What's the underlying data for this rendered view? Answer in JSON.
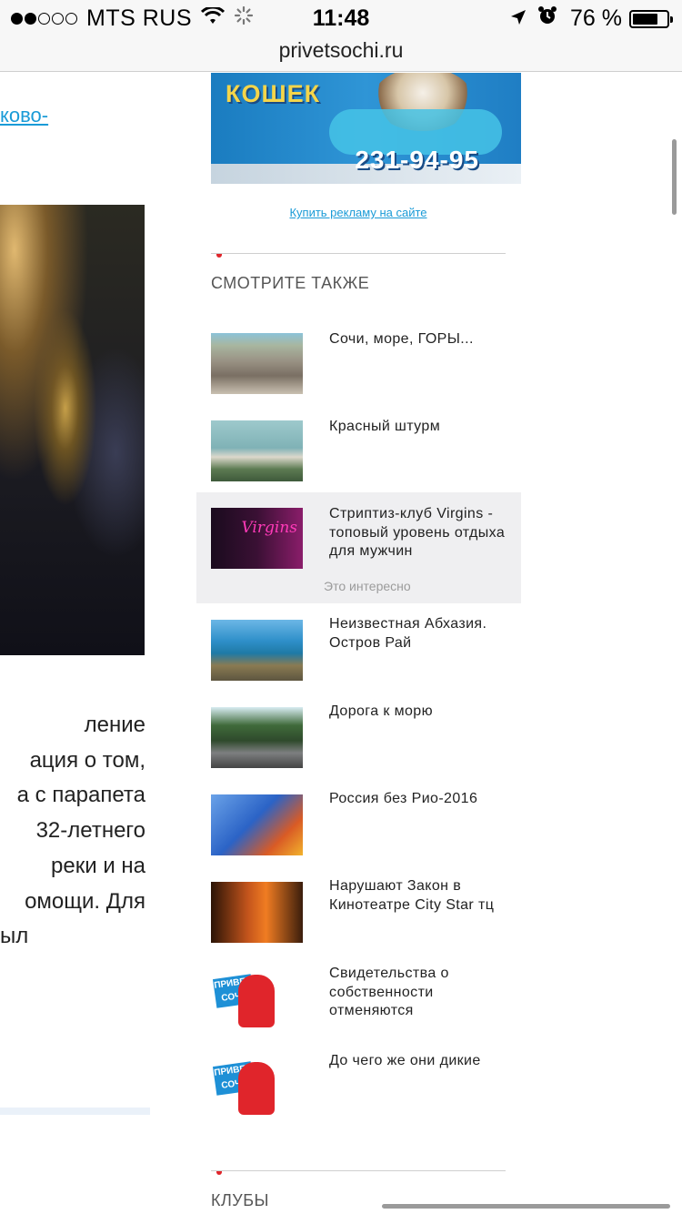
{
  "status_bar": {
    "carrier": "MTS RUS",
    "time": "11:48",
    "battery": "76 %",
    "battery_level": 0.76,
    "signal_bars_filled": 2,
    "signal_bars_total": 5
  },
  "url_bar": {
    "domain": "privetsochi.ru"
  },
  "article": {
    "link_text": "ково-",
    "text_lines": [
      "ление",
      "ация о том,",
      "а с парапета",
      "32-летнего",
      "реки и на",
      "омощи. Для",
      "ыл"
    ]
  },
  "ad": {
    "title": "КОШЕК",
    "phone": "231-94-95",
    "buy_link": "Купить рекламу на сайте"
  },
  "see_also": {
    "heading": "СМОТРИТЕ ТАКЖЕ",
    "items": [
      {
        "title": "Сочи, море, ГОРЫ..."
      },
      {
        "title": "Красный штурм"
      },
      {
        "title": "Стриптиз-клуб Virgins - топовый уровень отдыха для мужчин",
        "note": "Это интересно",
        "thumb_text": "Virgins"
      },
      {
        "title": "Неизвестная Абхазия. Остров Рай"
      },
      {
        "title": "Дорога к морю"
      },
      {
        "title": "Россия без Рио-2016"
      },
      {
        "title": "Нарушают Закон в Кинотеатре City Star тц"
      },
      {
        "title": "Свидетельства о собственности отменяются",
        "logo_text": "ПРИВЕТ СОЧИ"
      },
      {
        "title": "До чего же они дикие",
        "logo_text": "ПРИВЕТ СОЧИ"
      }
    ]
  },
  "clubs": {
    "heading": "КЛУБЫ"
  }
}
